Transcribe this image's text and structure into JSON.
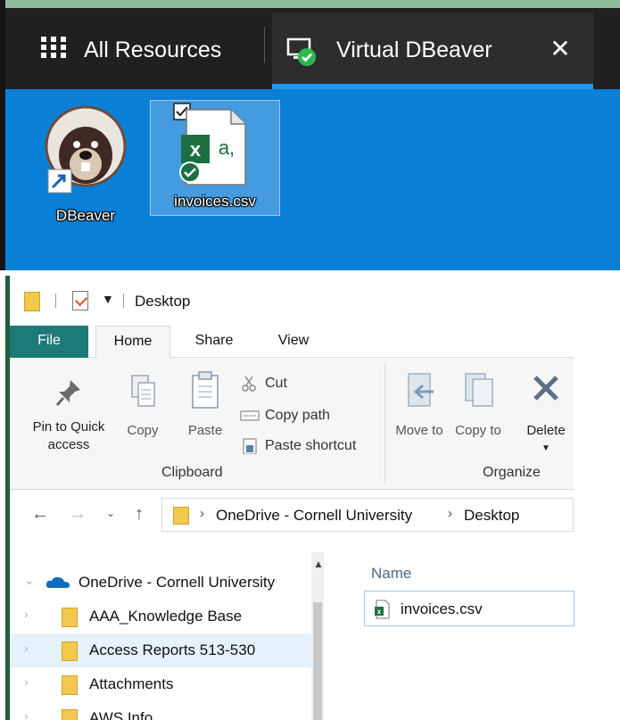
{
  "tabs": {
    "all_resources": "All Resources",
    "active": "Virtual DBeaver",
    "close_glyph": "✕"
  },
  "desktop": {
    "icons": [
      {
        "label": "DBeaver",
        "icon": "dbeaver-shortcut-icon"
      },
      {
        "label": "invoices.csv",
        "icon": "excel-csv-icon",
        "selected": true
      }
    ],
    "background": "#0a7fd6"
  },
  "explorer": {
    "title": "Desktop",
    "ribbon_tabs": [
      "File",
      "Home",
      "Share",
      "View"
    ],
    "ribbon": {
      "pin": "Pin to Quick access",
      "copy": "Copy",
      "paste": "Paste",
      "cut": "Cut",
      "copy_path": "Copy path",
      "paste_shortcut": "Paste shortcut",
      "clipboard_group": "Clipboard",
      "move_to": "Move to",
      "copy_to": "Copy to",
      "delete": "Delete",
      "organize_group": "Organize"
    },
    "address": {
      "crumbs": [
        "OneDrive - Cornell University",
        "Desktop"
      ]
    },
    "nav_tree": [
      {
        "label": "OneDrive - Cornell University",
        "icon": "onedrive-cloud-icon"
      },
      {
        "label": "AAA_Knowledge Base",
        "icon": "folder-icon"
      },
      {
        "label": "Access Reports 513-530",
        "icon": "folder-icon",
        "selected": true
      },
      {
        "label": "Attachments",
        "icon": "folder-icon"
      },
      {
        "label": "AWS Info",
        "icon": "folder-icon"
      }
    ],
    "content": {
      "column_name": "Name",
      "files": [
        {
          "name": "invoices.csv",
          "icon": "excel-csv-icon"
        }
      ]
    }
  },
  "colors": {
    "tab_underline": "#1d9bf0",
    "file_tab": "#1c7a78",
    "excel_green": "#1d6f42",
    "selection": "#e5f1fb"
  }
}
